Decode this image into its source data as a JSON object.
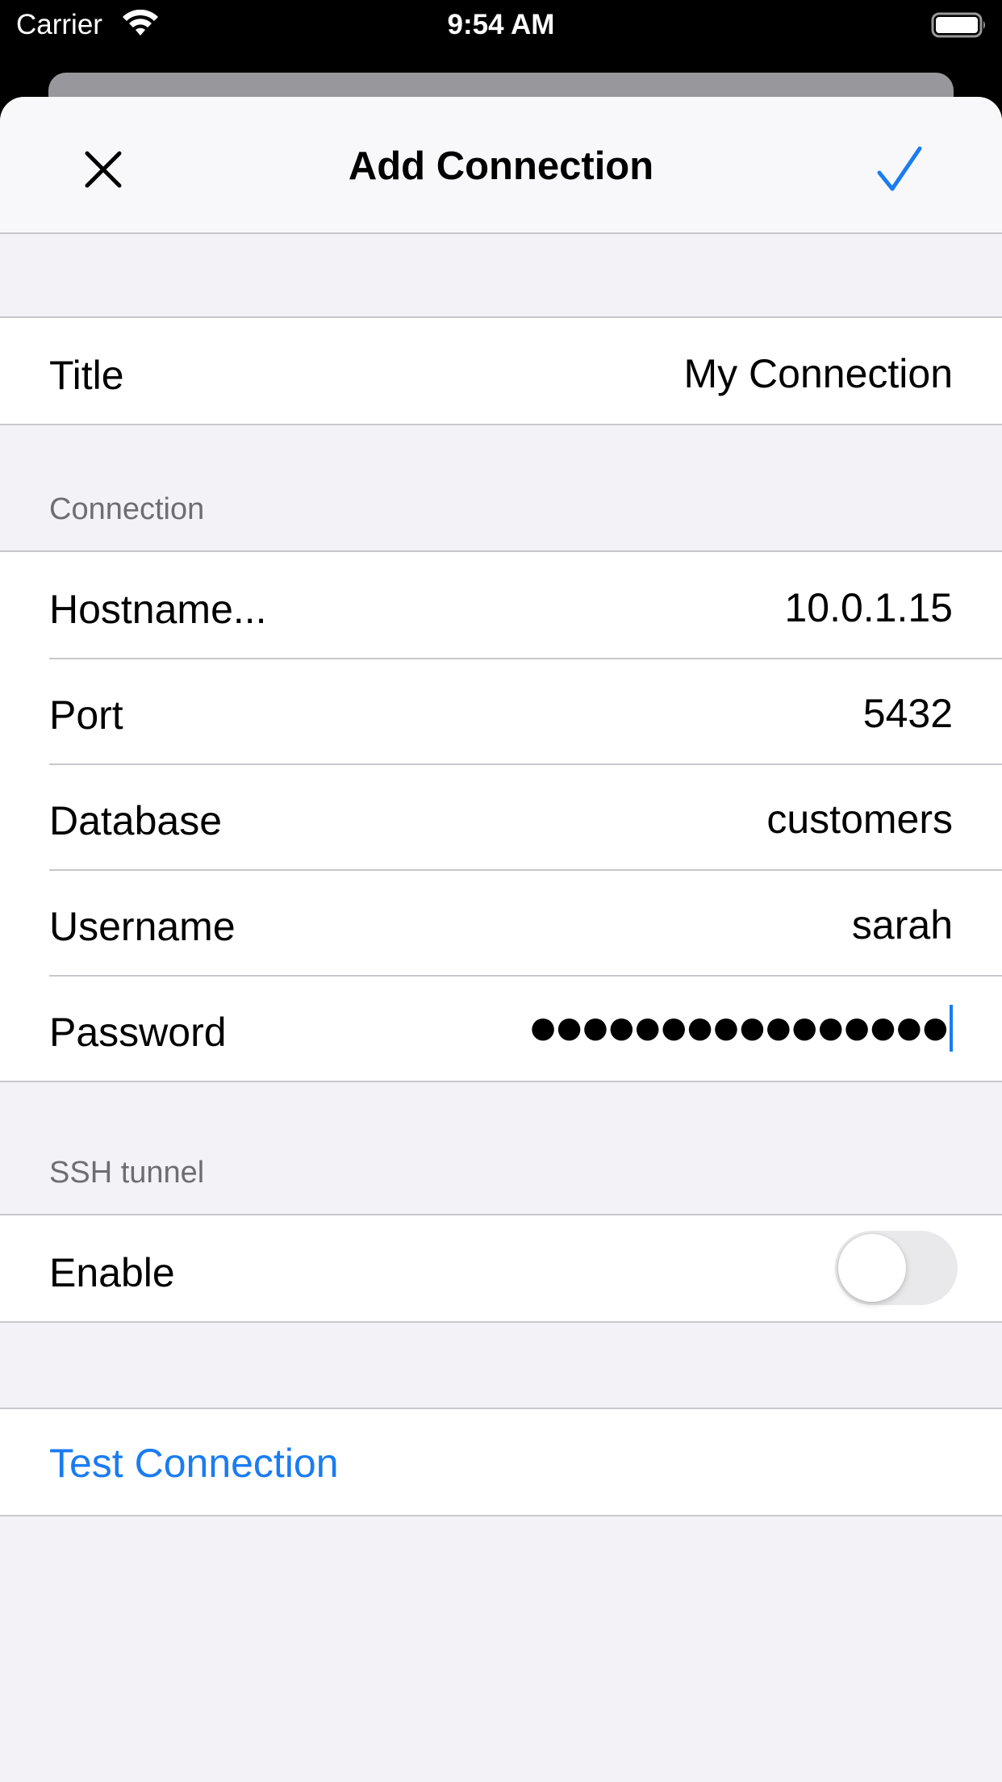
{
  "status_bar": {
    "carrier": "Carrier",
    "time": "9:54 AM",
    "wifi_icon": "wifi-icon",
    "battery_icon": "battery-icon"
  },
  "nav": {
    "title": "Add Connection",
    "close_icon": "close-icon",
    "done_icon": "checkmark-icon",
    "accent_color": "#1a7cf2"
  },
  "general": {
    "title_label": "Title",
    "title_value": "My Connection"
  },
  "connection": {
    "header": "Connection",
    "hostname_label": "Hostname...",
    "hostname_value": "10.0.1.15",
    "port_label": "Port",
    "port_value": "5432",
    "database_label": "Database",
    "database_value": "customers",
    "username_label": "Username",
    "username_value": "sarah",
    "password_label": "Password",
    "password_masked": "●●●●●●●●●●●●●●●●"
  },
  "ssh_tunnel": {
    "header": "SSH tunnel",
    "enable_label": "Enable",
    "enabled": false
  },
  "actions": {
    "test_connection_label": "Test Connection"
  }
}
